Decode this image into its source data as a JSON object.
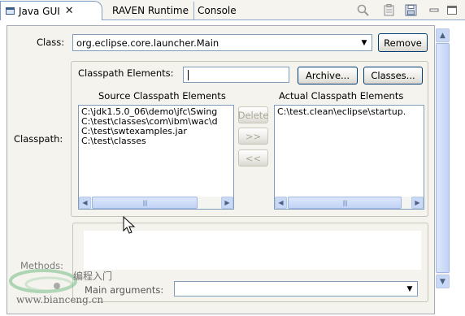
{
  "tabs": [
    {
      "label": "Java GUI",
      "close": "✕",
      "active": true
    },
    {
      "label": "RAVEN Runtime",
      "active": false
    },
    {
      "label": "Console",
      "active": false
    }
  ],
  "class_field": {
    "label": "Class:",
    "value": "org.eclipse.core.launcher.Main",
    "remove_label": "Remove"
  },
  "classpath": {
    "label": "Classpath:",
    "elements_label": "Classpath Elements:",
    "elements_value": "",
    "archive_label": "Archive...",
    "classes_label": "Classes...",
    "source_title": "Source Classpath Elements",
    "actual_title": "Actual Classpath Elements",
    "source_items": [
      "C:\\jdk1.5.0_06\\demo\\jfc\\Swing",
      "C:\\test\\classes\\com\\ibm\\wac\\d",
      "C:\\test\\swtexamples.jar",
      "C:\\test\\classes"
    ],
    "actual_items": [
      "C:\\test.clean\\eclipse\\startup."
    ],
    "delete_label": "Delete",
    "add_label": ">>",
    "remove_label": "<<"
  },
  "methods": {
    "label": "Methods:",
    "main_arguments_label": "Main arguments:",
    "main_arguments_value": ""
  },
  "watermark": {
    "site_name": "编程入门",
    "url": "www.bianceng.cn"
  },
  "colors": {
    "panel_bg": "#f4f3ee",
    "button_border": "#003c74",
    "scrollbar_blue": "#c9d8f5",
    "field_border": "#7f9db9"
  }
}
